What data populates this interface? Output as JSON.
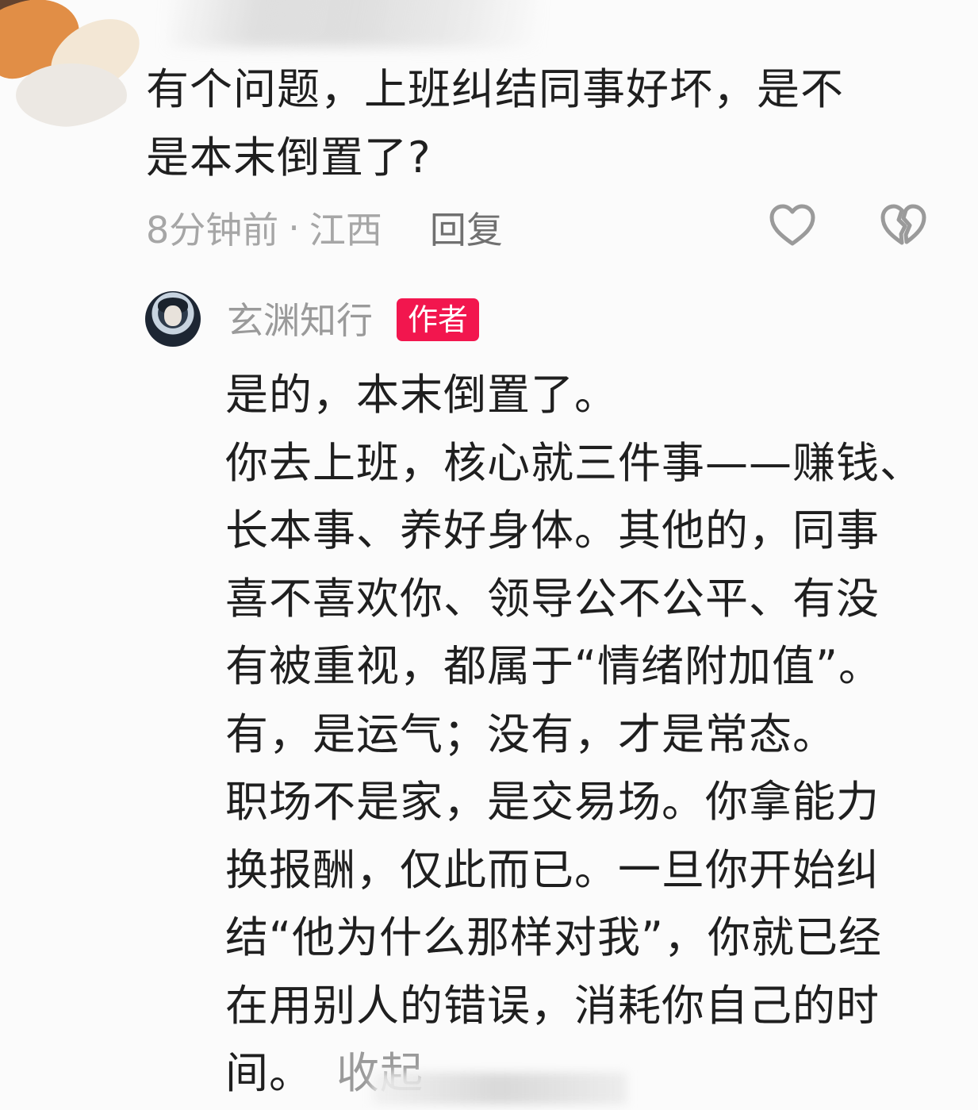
{
  "comment": {
    "text_line1": "有个问题，上班纠结同事好坏，是不",
    "text_line2": "是本末倒置了?",
    "time": "8分钟前",
    "separator": "·",
    "location": "江西",
    "reply_label": "回复"
  },
  "reply": {
    "author_name": "玄渊知行",
    "author_badge": "作者",
    "lines": [
      "是的，本末倒置了。",
      "你去上班，核心就三件事——赚钱、",
      "长本事、养好身体。其他的，同事",
      "喜不喜欢你、领导公不公平、有没",
      "有被重视，都属于“情绪附加值”。",
      "有，是运气；没有，才是常态。",
      "职场不是家，是交易场。你拿能力",
      "换报酬，仅此而已。一旦你开始纠",
      "结“他为什么那样对我”，你就已经",
      "在用别人的错误，消耗你自己的时",
      "间。"
    ],
    "collapse_label": "收起"
  },
  "icons": {
    "like": "heart-outline-icon",
    "dislike": "broken-heart-outline-icon"
  },
  "colors": {
    "badge": "#f2164e",
    "text": "#1f1f1f",
    "muted": "#9a9a9a"
  }
}
